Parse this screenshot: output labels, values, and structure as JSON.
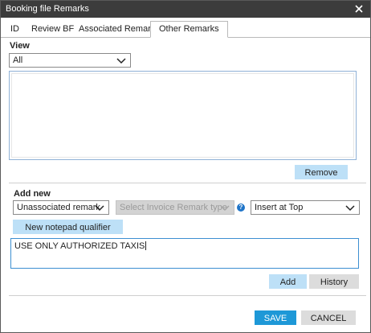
{
  "window": {
    "title": "Booking file Remarks",
    "close_icon": "close-icon"
  },
  "tabs": [
    {
      "label": "ID",
      "active": false
    },
    {
      "label": "Review BF",
      "active": false
    },
    {
      "label": "Associated Remarks",
      "active": false
    },
    {
      "label": "Other Remarks",
      "active": true
    }
  ],
  "view": {
    "label": "View",
    "select_value": "All",
    "remove_label": "Remove"
  },
  "add_new": {
    "label": "Add new",
    "remark_type_value": "Unassociated remark",
    "invoice_type_placeholder": "Select Invoice Remark type",
    "insert_position_value": "Insert at Top",
    "qualifier_button": "New notepad qualifier",
    "remark_text": "USE ONLY AUTHORIZED TAXIS",
    "add_label": "Add",
    "history_label": "History"
  },
  "footer": {
    "save_label": "SAVE",
    "cancel_label": "CANCEL"
  },
  "colors": {
    "titlebar": "#3c3c3c",
    "accent_button": "#1e98d7",
    "light_button": "#bde0f7",
    "gray_button": "#dcdcdc",
    "help_icon": "#1e74c8"
  }
}
